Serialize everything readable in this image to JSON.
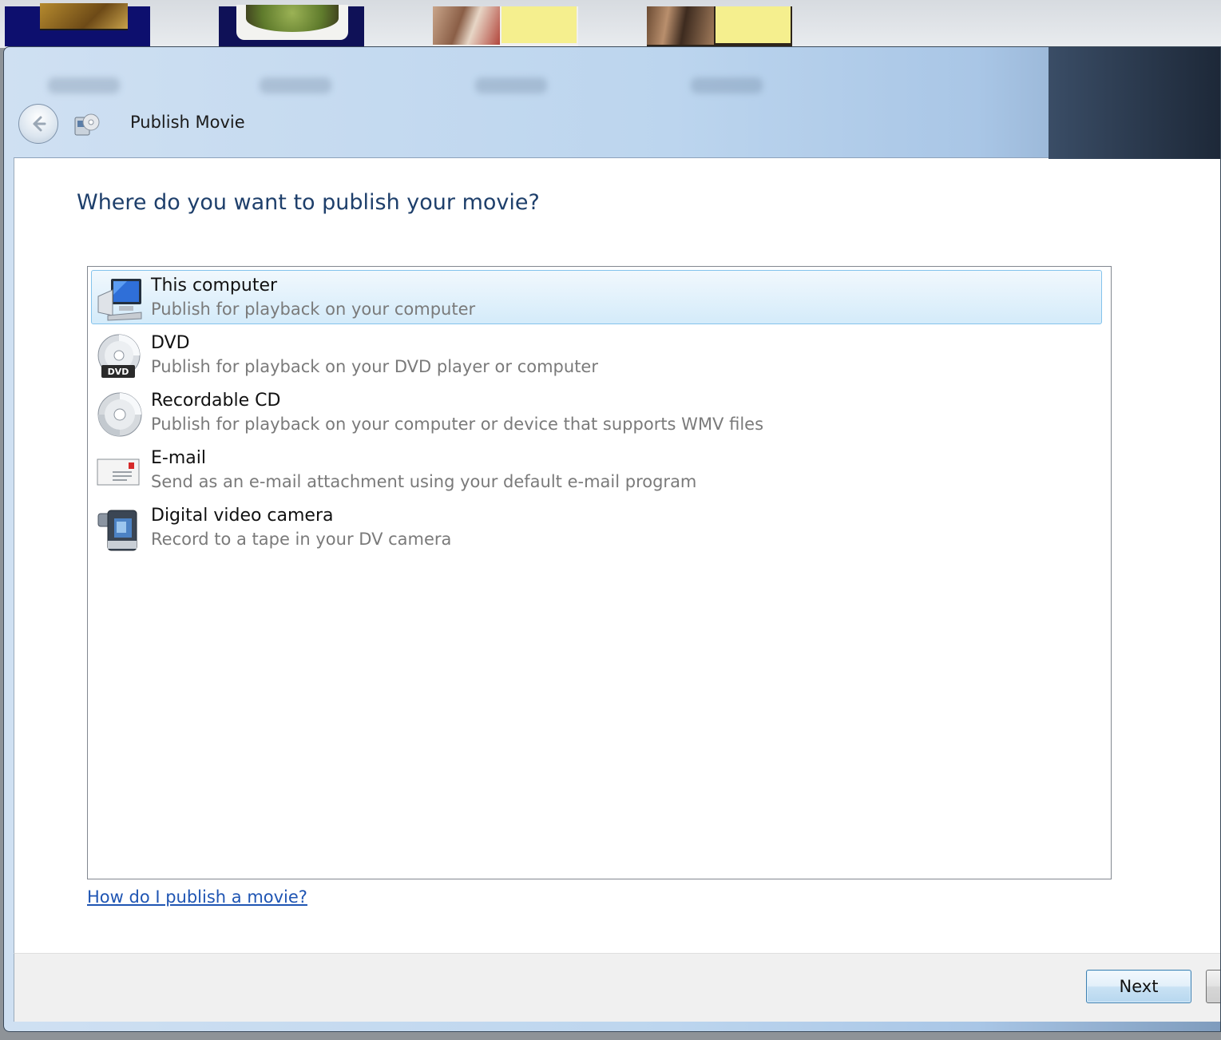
{
  "window": {
    "title": "Publish Movie"
  },
  "page": {
    "heading": "Where do you want to publish your movie?"
  },
  "options": [
    {
      "title": "This computer",
      "description": "Publish for playback on your computer",
      "icon": "computer-icon",
      "selected": true
    },
    {
      "title": "DVD",
      "description": "Publish for playback on your DVD player or computer",
      "icon": "dvd-icon",
      "selected": false
    },
    {
      "title": "Recordable CD",
      "description": "Publish for playback on your computer or device that supports WMV files",
      "icon": "cd-icon",
      "selected": false
    },
    {
      "title": "E-mail",
      "description": "Send as an e-mail attachment using your default e-mail program",
      "icon": "email-icon",
      "selected": false
    },
    {
      "title": "Digital video camera",
      "description": "Record to a tape in your DV camera",
      "icon": "video-camera-icon",
      "selected": false
    }
  ],
  "help": {
    "link": "How do I publish a movie?"
  },
  "footer": {
    "next_label": "Next"
  },
  "colors": {
    "heading": "#1e3f6b",
    "link": "#1f55b3",
    "selection_border": "#84c3ec",
    "description_text": "#7a7a7a"
  }
}
